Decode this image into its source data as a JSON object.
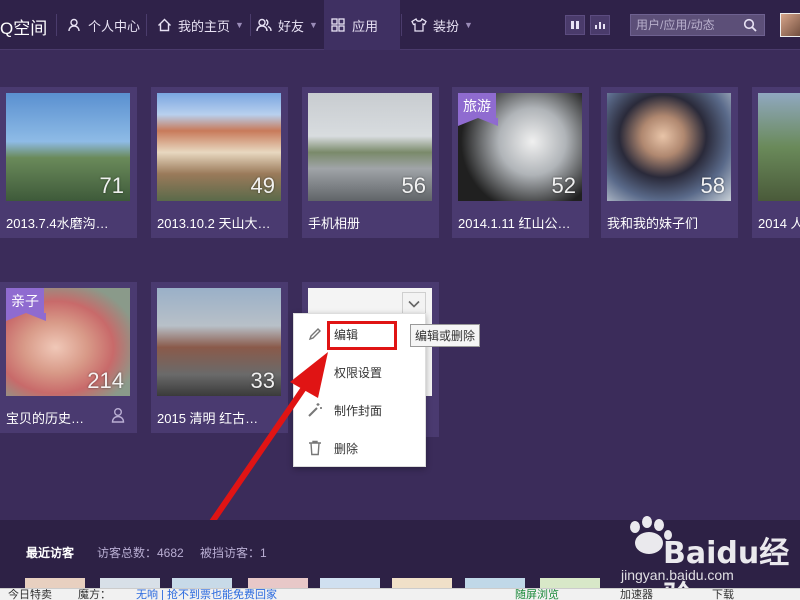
{
  "nav": {
    "brand": "Q空间",
    "items": [
      {
        "label": "个人中心"
      },
      {
        "label": "我的主页"
      },
      {
        "label": "好友"
      },
      {
        "label": "应用"
      },
      {
        "label": "装扮"
      }
    ],
    "search_placeholder": "用户/应用/动态"
  },
  "albums": [
    {
      "title": "2013.7.4水磨沟…",
      "count": "71",
      "tag": ""
    },
    {
      "title": "2013.10.2 天山大…",
      "count": "49",
      "tag": ""
    },
    {
      "title": "手机相册",
      "count": "56",
      "tag": ""
    },
    {
      "title": "2014.1.11 红山公…",
      "count": "52",
      "tag": "旅游"
    },
    {
      "title": "我和我的妹子们",
      "count": "58",
      "tag": ""
    },
    {
      "title": "2014 人",
      "count": "",
      "tag": ""
    },
    {
      "title": "宝贝的历史…",
      "count": "214",
      "tag": "亲子"
    },
    {
      "title": "2015 清明 红古…",
      "count": "33",
      "tag": ""
    }
  ],
  "context_menu": {
    "items": [
      {
        "label": "编辑",
        "icon": "pencil-icon"
      },
      {
        "label": "权限设置",
        "icon": "lock-icon"
      },
      {
        "label": "制作封面",
        "icon": "magic-wand-icon"
      },
      {
        "label": "删除",
        "icon": "trash-icon"
      }
    ],
    "tooltip": "编辑或删除"
  },
  "visitors": {
    "title": "最近访客",
    "total_label": "访客总数：4682",
    "blocked_label": "被挡访客：1"
  },
  "statusbar": {
    "items": [
      "今日特卖",
      "魔方：",
      "无响 | 抢不到票也能免费回家",
      "随屏浏览",
      "加速器",
      "下载"
    ]
  },
  "watermark": {
    "brand": "Baidu经验",
    "url": "jingyan.baidu.com"
  },
  "colors": {
    "page_bg": "#3b2c5a",
    "nav_bg": "#2f2249",
    "card_bg": "#4a3a70",
    "tag_bg": "#8f6bd0",
    "highlight_red": "#e01414"
  }
}
